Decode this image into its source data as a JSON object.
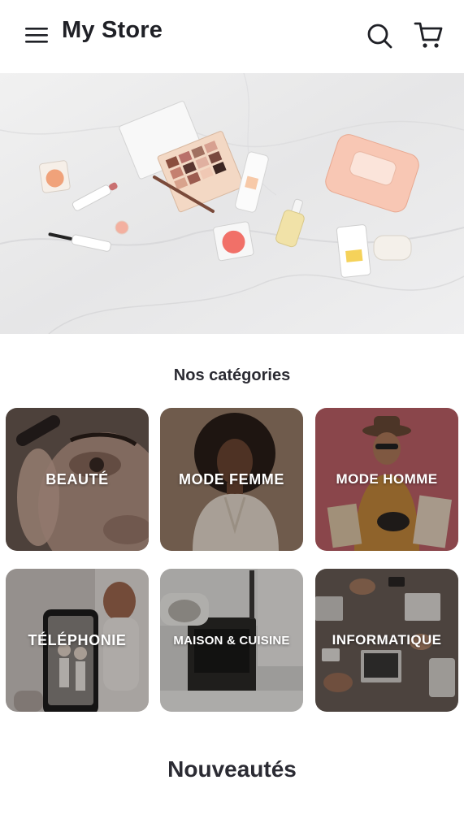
{
  "header": {
    "title": "My Store",
    "menu_icon": "hamburger-menu-icon",
    "search_icon": "search-icon",
    "cart_icon": "shopping-cart-icon"
  },
  "hero": {
    "image": "makeup-flatlay-banner"
  },
  "categories": {
    "title": "Nos catégories",
    "items": [
      {
        "label": "BEAUTÉ",
        "image": "beauty-eye-closeup"
      },
      {
        "label": "MODE FEMME",
        "image": "woman-curly-hair-portrait"
      },
      {
        "label": "MODE HOMME",
        "image": "man-hat-shopping-bags"
      },
      {
        "label": "TÉLÉPHONIE",
        "image": "smartphone-photo"
      },
      {
        "label": "MAISON & CUISINE",
        "image": "kitchen-oven"
      },
      {
        "label": "INFORMATIQUE",
        "image": "desk-laptops-overhead"
      }
    ]
  },
  "new_arrivals": {
    "title": "Nouveautés"
  },
  "colors": {
    "text": "#2b2b33",
    "tile_overlay_text": "#ffffff",
    "hero_background": "#ececec"
  }
}
